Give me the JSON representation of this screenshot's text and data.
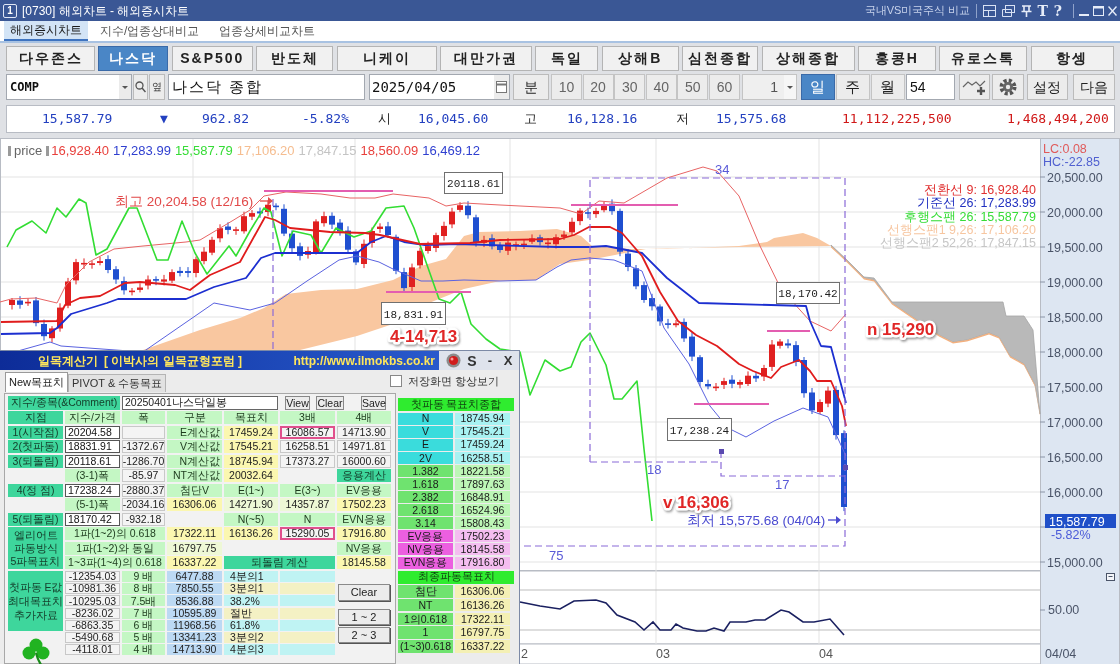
{
  "window": {
    "badge": "1",
    "title": "[0730] 해외차트 - 해외증시차트",
    "compare_link": "국내VS미국주식 비교",
    "tools": [
      "T",
      "?"
    ]
  },
  "menu_tabs": [
    {
      "label": "해외증시차트",
      "selected": true
    },
    {
      "label": "지수/업종상대비교",
      "selected": false
    },
    {
      "label": "업종상세비교차트",
      "selected": false
    }
  ],
  "markets": [
    {
      "label": "다우존스",
      "selected": false
    },
    {
      "label": "나스닥",
      "selected": true
    },
    {
      "label": "S&P500",
      "selected": false
    },
    {
      "label": "반도체",
      "selected": false
    },
    {
      "label": "니케이",
      "selected": false
    },
    {
      "label": "대만가권",
      "selected": false
    },
    {
      "label": "독일",
      "selected": false
    },
    {
      "label": "상해B",
      "selected": false
    },
    {
      "label": "심천종합",
      "selected": false
    },
    {
      "label": "상해종합",
      "selected": false
    },
    {
      "label": "홍콩H",
      "selected": false
    },
    {
      "label": "유로스톡",
      "selected": false
    },
    {
      "label": "항셍",
      "selected": false
    }
  ],
  "toolbar": {
    "symbol": "COMP",
    "link_button": "옆",
    "name": "나스닥 종합",
    "date": "2025/04/05",
    "minute_button": "분",
    "minute_steps": [
      "10",
      "20",
      "30",
      "40",
      "50",
      "60"
    ],
    "multiplier": "1",
    "periods": [
      {
        "label": "일",
        "selected": true
      },
      {
        "label": "주",
        "selected": false
      },
      {
        "label": "월",
        "selected": false
      }
    ],
    "bar_count": "54",
    "settings_button": "설정",
    "next_button": "다음"
  },
  "quote": {
    "last": "15,587.79",
    "direction": "▼",
    "change": "962.82",
    "change_rate": "-5.82%",
    "open_label": "시",
    "open": "16,045.60",
    "high_label": "고",
    "high": "16,128.16",
    "low_label": "저",
    "low": "15,575.68",
    "volume": "11,112,225,500",
    "amount": "1,468,494,200"
  },
  "chart": {
    "legend_title": "price",
    "legend_values": [
      {
        "text": "16,928.40",
        "color": "#e8403c"
      },
      {
        "text": "17,283.99",
        "color": "#2f3fd0"
      },
      {
        "text": "15,587.79",
        "color": "#36dc36"
      },
      {
        "text": "17,106.20",
        "color": "#f5bd90"
      },
      {
        "text": "17,847.15",
        "color": "#c4c4c4"
      },
      {
        "text": "18,560.09",
        "color": "#e8403c"
      },
      {
        "text": "16,469.12",
        "color": "#2f3fd0"
      }
    ],
    "scale_stats": [
      {
        "text": "LC:0.08",
        "color": "#e05a5a"
      },
      {
        "text": "HC:-22.85",
        "color": "#5060d0"
      }
    ],
    "indicator_labels": [
      {
        "text": "전환선 9: 16,928.40",
        "color": "#e03030"
      },
      {
        "text": "기준선 26: 17,283.99",
        "color": "#2030c0"
      },
      {
        "text": "후행스팬 26: 15,587.79",
        "color": "#36dc36"
      },
      {
        "text": "선행스팬1 9,26: 17,106.20",
        "color": "#f7c6a0"
      },
      {
        "text": "선행스팬2 52,26: 17,847.15",
        "color": "#c6c6c6"
      }
    ],
    "y_ticks": [
      "20,500.00",
      "20,000.00",
      "19,500.00",
      "19,000.00",
      "18,500.00",
      "18,000.00",
      "17,500.00",
      "17,000.00",
      "16,500.00",
      "16,000.00",
      "15,000.00"
    ],
    "current_price": "15,587.79",
    "current_change": "-5.82%",
    "annotations": [
      {
        "kind": "peak",
        "text": "최고 20,204.58 (12/16)"
      },
      {
        "kind": "callout",
        "text": "20118.61"
      },
      {
        "kind": "callout",
        "text": "18,831.91"
      },
      {
        "kind": "target",
        "text": "4-14,713"
      },
      {
        "kind": "count",
        "text": "34"
      },
      {
        "kind": "callout",
        "text": "18,170.42"
      },
      {
        "kind": "target",
        "text": "n 15,290"
      },
      {
        "kind": "callout",
        "text": "17,238.24"
      },
      {
        "kind": "count",
        "text": "18"
      },
      {
        "kind": "count",
        "text": "17"
      },
      {
        "kind": "target",
        "text": "v 16,306"
      },
      {
        "kind": "trough",
        "text": "최저 15,575.68 (04/04)"
      },
      {
        "kind": "count",
        "text": "75"
      }
    ],
    "lower_y_tick": "50.00",
    "x_labels": [
      "2",
      "03",
      "04"
    ],
    "last_date": "04/04"
  },
  "calculator": {
    "title": "일목계산기",
    "subtitle": "[ 이박사의 일목균형포럼 ]",
    "url": "http://www.ilmokbs.co.kr",
    "s_button": "S",
    "minimize_button": "-",
    "close_button": "X",
    "tabs": [
      {
        "label": "New목표치",
        "selected": true
      },
      {
        "label": "PIVOT & 수동목표",
        "selected": false
      }
    ],
    "always_show": {
      "label": "저장화면 항상보기",
      "checked": false
    },
    "comment": {
      "label": "지수/종목(&Comment)",
      "value": "20250401나스닥일봉",
      "buttons": [
        "View",
        "Clear",
        "Save"
      ]
    },
    "grid": [
      [
        {
          "kind": "label",
          "text": "지점"
        },
        {
          "kind": "head",
          "text": "지수/가격"
        },
        {
          "kind": "head",
          "text": "폭"
        },
        {
          "kind": "head",
          "text": "구분"
        },
        {
          "kind": "head",
          "text": "목표치"
        },
        {
          "kind": "head",
          "text": "3배"
        },
        {
          "kind": "head",
          "text": "4배"
        }
      ],
      [
        {
          "kind": "label",
          "text": "1(시작점)"
        },
        {
          "kind": "input",
          "text": "20204.58"
        },
        {
          "kind": "empty"
        },
        {
          "kind": "calc",
          "text": "E계산값"
        },
        {
          "kind": "yellow",
          "text": "17459.24"
        },
        {
          "kind": "marked",
          "text": "16086.57"
        },
        {
          "kind": "value",
          "text": "14713.90"
        }
      ],
      [
        {
          "kind": "label",
          "text": "2(첫파동)"
        },
        {
          "kind": "input",
          "text": "18831.91"
        },
        {
          "kind": "value",
          "text": "-1372.67"
        },
        {
          "kind": "calc",
          "text": "V계산값"
        },
        {
          "kind": "yellow",
          "text": "17545.21"
        },
        {
          "kind": "value",
          "text": "16258.51"
        },
        {
          "kind": "value",
          "text": "14971.81"
        }
      ],
      [
        {
          "kind": "label",
          "text": "3(되돌림)"
        },
        {
          "kind": "input",
          "text": "20118.61"
        },
        {
          "kind": "value",
          "text": "-1286.70"
        },
        {
          "kind": "calc",
          "text": "N계산값"
        },
        {
          "kind": "yellow",
          "text": "18745.94"
        },
        {
          "kind": "value",
          "text": "17373.27"
        },
        {
          "kind": "value",
          "text": "16000.60"
        }
      ],
      [
        {
          "kind": "head",
          "text": "(3-1)폭"
        },
        {
          "kind": "value",
          "text": "-85.97"
        },
        {
          "kind": "calc",
          "text": "NT계산값"
        },
        {
          "kind": "yellow",
          "text": "20032.64"
        },
        {
          "kind": "section",
          "text": "응용계산"
        }
      ],
      [
        {
          "kind": "label",
          "text": "4(정 점)"
        },
        {
          "kind": "input",
          "text": "17238.24"
        },
        {
          "kind": "value",
          "text": "-2880.37"
        },
        {
          "kind": "head",
          "text": "첨단V"
        },
        {
          "kind": "head",
          "text": "E(1~)"
        },
        {
          "kind": "head",
          "text": "E(3~)"
        },
        {
          "kind": "head",
          "text": "EV응용"
        }
      ],
      [
        {
          "kind": "head",
          "text": "(5-1)폭"
        },
        {
          "kind": "value",
          "text": "-2034.16"
        },
        {
          "kind": "yellow",
          "text": "16306.06"
        },
        {
          "kind": "pale",
          "text": "14271.90"
        },
        {
          "kind": "pale",
          "text": "14357.87"
        },
        {
          "kind": "yellow",
          "text": "17502.23"
        }
      ],
      [
        {
          "kind": "label",
          "text": "5(되돌림)"
        },
        {
          "kind": "input",
          "text": "18170.42"
        },
        {
          "kind": "value",
          "text": "-932.18"
        },
        {
          "kind": "head",
          "text": "N(~5)"
        },
        {
          "kind": "head",
          "text": "N"
        },
        {
          "kind": "head",
          "text": "EVN응용"
        }
      ],
      [
        {
          "kind": "label",
          "text": "엘리어트 파동방식 5파목표치"
        },
        {
          "kind": "head",
          "text": "1파(1~2)의 0.618"
        },
        {
          "kind": "yellow",
          "text": "17322.11"
        },
        {
          "kind": "yellow",
          "text": "16136.26"
        },
        {
          "kind": "marked",
          "text": "15290.05"
        },
        {
          "kind": "yellow",
          "text": "17916.80"
        }
      ],
      [
        {
          "kind": "head",
          "text": "1파(1~2)와 동일"
        },
        {
          "kind": "pale",
          "text": "16797.75"
        },
        {
          "kind": "head",
          "text": "NV응용"
        }
      ],
      [
        {
          "kind": "head",
          "text": "1~3파(1~4)의 0.618"
        },
        {
          "kind": "yellow",
          "text": "16337.22"
        },
        {
          "kind": "section",
          "text": "되돌림 계산"
        },
        {
          "kind": "yellow",
          "text": "18145.58"
        }
      ]
    ],
    "extra": {
      "label": "첫파동 E값 최대목표치 추가자료",
      "rows": [
        {
          "base": "-12354.03",
          "factor": "9 배",
          "result": "6477.88",
          "ratio": "4분의1",
          "kind": "cyan"
        },
        {
          "base": "-10981.36",
          "factor": "8 배",
          "result": "7850.55",
          "ratio": "3분의1",
          "kind": "pale"
        },
        {
          "base": "-10295.03",
          "factor": "7.5배",
          "result": "8536.88",
          "ratio": "38.2%",
          "kind": "cyan"
        },
        {
          "base": "-8236.02",
          "factor": "7 배",
          "result": "10595.89",
          "ratio": "절반",
          "kind": "pale"
        },
        {
          "base": "-6863.35",
          "factor": "6 배",
          "result": "11968.56",
          "ratio": "61.8%",
          "kind": "cyan"
        },
        {
          "base": "-5490.68",
          "factor": "5 배",
          "result": "13341.23",
          "ratio": "3분의2",
          "kind": "pale"
        },
        {
          "base": "-4118.01",
          "factor": "4 배",
          "result": "14713.90",
          "ratio": "4분의3",
          "kind": "cyan"
        }
      ]
    },
    "side_buttons": [
      "Clear",
      "1 ~ 2",
      "2 ~ 3"
    ],
    "summary": {
      "title": "첫파동 목표치종합",
      "rows": [
        {
          "label": "N",
          "value": "18745.94",
          "kind": "wave"
        },
        {
          "label": "V",
          "value": "17545.21",
          "kind": "wave"
        },
        {
          "label": "E",
          "value": "17459.24",
          "kind": "wave"
        },
        {
          "label": "2V",
          "value": "16258.51",
          "kind": "wave"
        },
        {
          "label": "1.382",
          "value": "18221.58",
          "kind": "ratio"
        },
        {
          "label": "1.618",
          "value": "17897.63",
          "kind": "ratio"
        },
        {
          "label": "2.382",
          "value": "16848.91",
          "kind": "ratio"
        },
        {
          "label": "2.618",
          "value": "16524.96",
          "kind": "ratio"
        },
        {
          "label": "3.14",
          "value": "15808.43",
          "kind": "ratio"
        },
        {
          "label": "EV응용",
          "value": "17502.23",
          "kind": "applied"
        },
        {
          "label": "NV응용",
          "value": "18145.58",
          "kind": "applied"
        },
        {
          "label": "EVN응용",
          "value": "17916.80",
          "kind": "applied"
        }
      ]
    },
    "final": {
      "title": "최종파동목표치",
      "rows": [
        {
          "label": "첨단",
          "value": "16306.06",
          "kind": "final"
        },
        {
          "label": "NT",
          "value": "16136.26",
          "kind": "final"
        },
        {
          "label": "1의0.618",
          "value": "17322.11",
          "kind": "final"
        },
        {
          "label": "1",
          "value": "16797.75",
          "kind": "final"
        },
        {
          "label": "(1~3)0.618",
          "value": "16337.22",
          "kind": "final"
        }
      ]
    }
  }
}
